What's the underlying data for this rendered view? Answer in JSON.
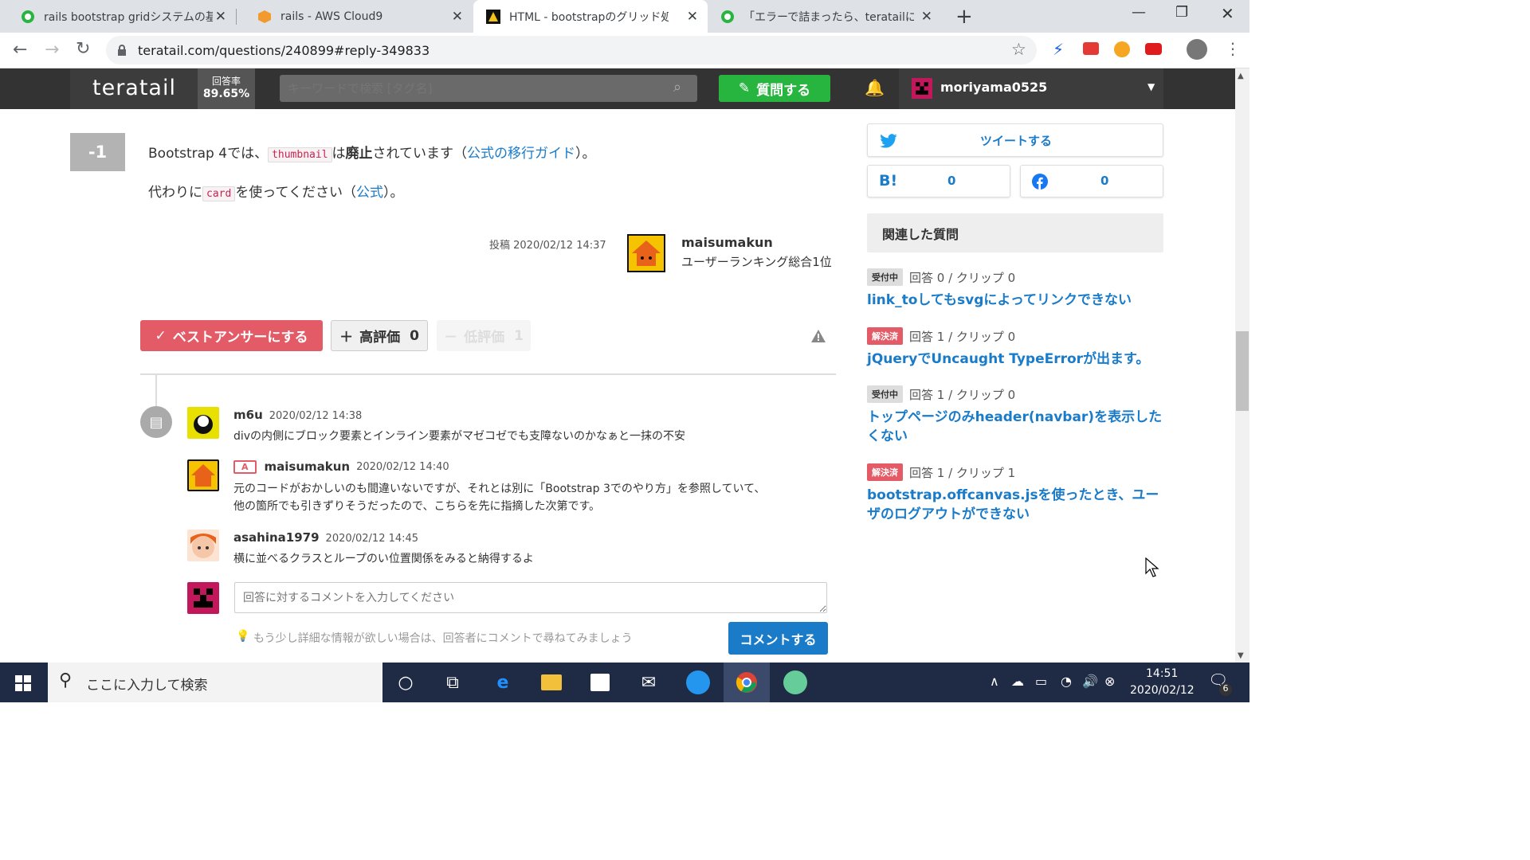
{
  "browser": {
    "tabs": [
      {
        "title": "rails bootstrap gridシステムの基本",
        "favicon": "teratail-icon"
      },
      {
        "title": "rails - AWS Cloud9",
        "favicon": "cloud9-icon"
      },
      {
        "title": "HTML - bootstrapのグリッド処理が",
        "favicon": "atcoder-icon",
        "active": true
      },
      {
        "title": "「エラーで詰まったら、teratailに相談す",
        "favicon": "teratail-icon"
      }
    ],
    "url": "teratail.com/questions/240899#reply-349833"
  },
  "site_header": {
    "logo": "teratail",
    "answer_rate_label": "回答率",
    "answer_rate_value": "89.65%",
    "search_placeholder": "キーワードで検索 [タグ名]",
    "ask_button": "質問する",
    "username": "moriyama0525"
  },
  "answer": {
    "vote": "-1",
    "line1_pre": "Bootstrap 4では、",
    "line1_code": "thumbnail",
    "line1_mid": "は",
    "line1_bold": "廃止",
    "line1_post": "されています（",
    "line1_link": "公式の移行ガイド",
    "line1_end": "）。",
    "line2_pre": "代わりに",
    "line2_code": "card",
    "line2_mid": "を使ってください（",
    "line2_link": "公式",
    "line2_end": "）。",
    "posted": "投稿 2020/02/12 14:37",
    "author": "maisumakun",
    "author_rank": "ユーザーランキング総合1位",
    "best_button": "ベストアンサーにする",
    "up_label": "高評価",
    "up_count": "0",
    "down_label": "低評価",
    "down_count": "1"
  },
  "comments": [
    {
      "user": "m6u",
      "date": "2020/02/12 14:38",
      "text": "divの内側にブロック要素とインライン要素がマゼコゼでも支障ないのかなぁと一抹の不安"
    },
    {
      "badge": "A",
      "user": "maisumakun",
      "date": "2020/02/12 14:40",
      "text1": "元のコードがおかしいのも間違いないですが、それとは別に「Bootstrap 3でのやり方」を参照していて、",
      "text2": "他の箇所でも引きずりそうだったので、こちらを先に指摘した次第です。"
    },
    {
      "user": "asahina1979",
      "date": "2020/02/12 14:45",
      "text": "横に並べるクラスとループのい位置関係をみると納得するよ"
    }
  ],
  "comment_form": {
    "placeholder": "回答に対するコメントを入力してください",
    "hint": "もう少し詳細な情報が欲しい場合は、回答者にコメントで尋ねてみましょう",
    "submit": "コメントする"
  },
  "sidebar": {
    "tweet": "ツイートする",
    "hatena_label": "B!",
    "hatena_count": "0",
    "facebook_count": "0",
    "related_title": "関連した質問",
    "related": [
      {
        "status": "受付中",
        "solved": false,
        "meta": "回答 0 / クリップ 0",
        "title": "link_toしてもsvgによってリンクできない"
      },
      {
        "status": "解決済",
        "solved": true,
        "meta": "回答 1 / クリップ 0",
        "title": "jQueryでUncaught TypeErrorが出ます。"
      },
      {
        "status": "受付中",
        "solved": false,
        "meta": "回答 1 / クリップ 0",
        "title": "トップページのみheader(navbar)を表示したくない"
      },
      {
        "status": "解決済",
        "solved": true,
        "meta": "回答 1 / クリップ 1",
        "title": "bootstrap.offcanvas.jsを使ったとき、ユーザのログアウトができない"
      }
    ]
  },
  "taskbar": {
    "search_placeholder": "ここに入力して検索",
    "time": "14:51",
    "date": "2020/02/12",
    "notification_count": "6"
  },
  "colors": {
    "accent_green": "#27b53f",
    "best_red": "#e35b66",
    "link_blue": "#1a7bc9"
  }
}
